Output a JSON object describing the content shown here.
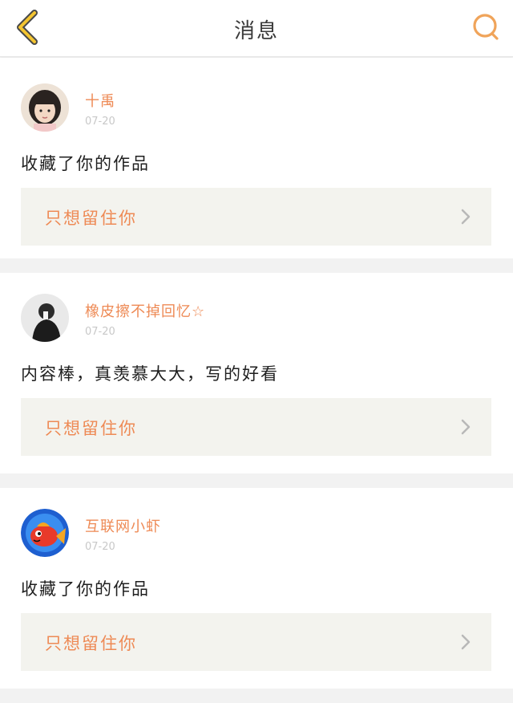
{
  "header": {
    "title": "消息",
    "back_icon": "chevron-left-icon",
    "search_icon": "search-icon",
    "accent_color": "#f0a45a"
  },
  "messages": [
    {
      "username": "十禹",
      "date": "07-20",
      "action": "收藏了你的作品",
      "work_title": "只想留住你",
      "avatar_icon": "avatar-girl-icon"
    },
    {
      "username": "橡皮擦不掉回忆☆",
      "date": "07-20",
      "action": "内容棒，真羡慕大大，写的好看",
      "work_title": "只想留住你",
      "avatar_icon": "avatar-dark-figure-icon"
    },
    {
      "username": "互联网小虾",
      "date": "07-20",
      "action": "收藏了你的作品",
      "work_title": "只想留住你",
      "avatar_icon": "avatar-fish-icon"
    }
  ]
}
